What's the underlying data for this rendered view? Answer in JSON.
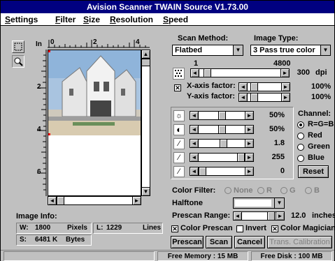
{
  "window": {
    "title": "Avision Scanner TWAIN Source V1.73.00"
  },
  "menu": {
    "items": [
      {
        "label": "Settings",
        "accel": "S",
        "rest": "ettings"
      },
      {
        "label": "Filter",
        "accel": "F",
        "rest": "ilter"
      },
      {
        "label": "Size",
        "accel": "S",
        "pre": "",
        "rest": "ize"
      },
      {
        "label": "Resolution",
        "accel": "R",
        "rest": "esolution"
      },
      {
        "label": "Speed",
        "accel": "S",
        "rest": "peed"
      }
    ]
  },
  "ruler": {
    "unit": "In",
    "h_ticks": [
      "0",
      "2",
      "4"
    ],
    "v_ticks": [
      "2",
      "4",
      "6"
    ]
  },
  "scan_method": {
    "label": "Scan Method:",
    "value": "Flatbed"
  },
  "image_type": {
    "label": "Image Type:",
    "value": "3 Pass true color"
  },
  "resolution": {
    "min": "1",
    "max": "4800",
    "value": "300",
    "unit": "dpi",
    "fraction": 0.06
  },
  "x_axis": {
    "label": "X-axis factor:",
    "value": "100%",
    "checked": true
  },
  "y_axis": {
    "label": "Y-axis factor:",
    "value": "100%"
  },
  "adjust": [
    {
      "icon": "brightness-icon",
      "glyph": "☼",
      "value": "50%",
      "fraction": 0.5
    },
    {
      "icon": "contrast-icon",
      "glyph": "◐",
      "value": "50%",
      "fraction": 0.5
    },
    {
      "icon": "gamma-icon",
      "glyph": "⁄",
      "value": "1.8",
      "fraction": 0.55
    },
    {
      "icon": "highlight-icon",
      "glyph": "⁄",
      "value": "255",
      "fraction": 1.0
    },
    {
      "icon": "shadow-icon",
      "glyph": "⁄",
      "value": "0",
      "fraction": 0.0
    }
  ],
  "channel": {
    "label": "Channel:",
    "options": [
      "R=G=B",
      "Red",
      "Green",
      "Blue"
    ],
    "selected": "R=G=B",
    "reset_label": "Reset"
  },
  "color_filter": {
    "label": "Color Filter:",
    "options": [
      "None",
      "R",
      "G",
      "B"
    ]
  },
  "halftone": {
    "label": "Halftone"
  },
  "prescan_range": {
    "label": "Prescan Range:",
    "value": "12.0",
    "unit": "inches"
  },
  "options": {
    "color_prescan": {
      "label": "Color Prescan",
      "checked": true
    },
    "invert": {
      "label": "Invert",
      "checked": false
    },
    "color_magician": {
      "label": "Color Magician",
      "checked": true
    }
  },
  "buttons": {
    "prescan": "Prescan",
    "scan": "Scan",
    "cancel": "Cancel",
    "calibration": "Trans. Calibration"
  },
  "image_info": {
    "label": "Image Info:",
    "w_label": "W:",
    "w_value": "1800",
    "w_unit": "Pixels",
    "l_label": "L:",
    "l_value": "1229",
    "l_unit": "Lines",
    "s_label": "S:",
    "s_value": "6481 K",
    "s_unit": "Bytes"
  },
  "status": {
    "free_memory": "Free Memory : 15 MB",
    "free_disk": "Free Disk : 100 MB"
  }
}
